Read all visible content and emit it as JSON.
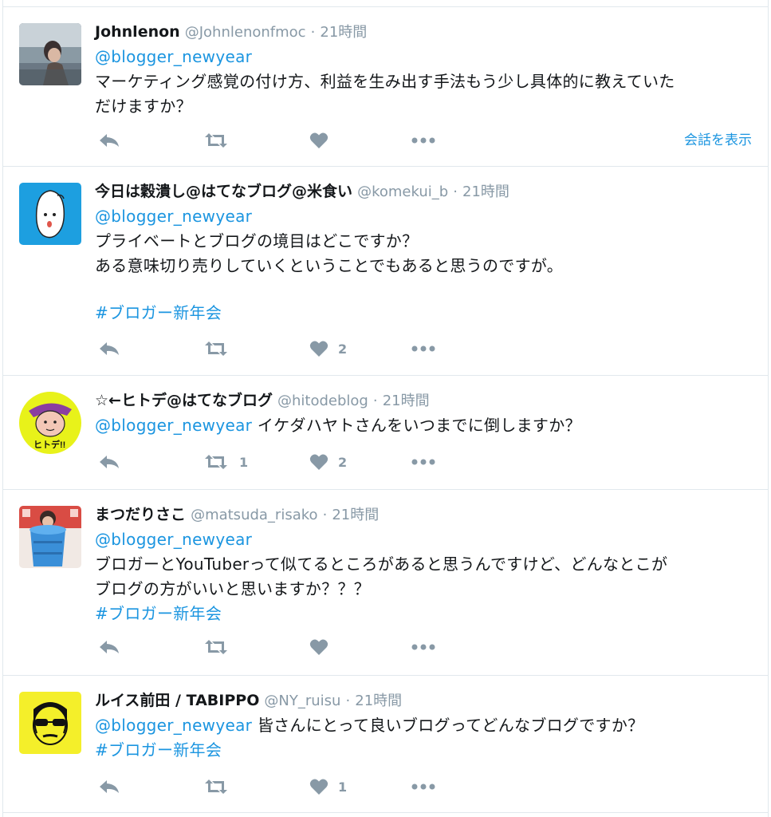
{
  "tweets": [
    {
      "name": "Johnlenon",
      "handle": "@Johnlenonfmoc",
      "time": "21時間",
      "lines": [
        [
          {
            "t": "mention",
            "v": "@blogger_newyear"
          }
        ],
        [
          {
            "t": "text",
            "v": "マーケティング感覚の付け方、利益を生み出す手法もう少し具体的に教えていた"
          }
        ],
        [
          {
            "t": "text",
            "v": "だけますか？"
          }
        ]
      ],
      "likes": "",
      "retweets": "",
      "show_conversation": "会話を表示"
    },
    {
      "name": "今日は穀潰し@はてなブログ@米食い",
      "handle": "@komekui_b",
      "time": "21時間",
      "lines": [
        [
          {
            "t": "mention",
            "v": "@blogger_newyear"
          }
        ],
        [
          {
            "t": "text",
            "v": "プライベートとブログの境目はどこですか？"
          }
        ],
        [
          {
            "t": "text",
            "v": "ある意味切り売りしていくということでもあると思うのですが。"
          }
        ],
        [
          {
            "t": "text",
            "v": ""
          }
        ],
        [
          {
            "t": "hashtag",
            "v": " #ブロガー新年会"
          }
        ]
      ],
      "likes": "2",
      "retweets": ""
    },
    {
      "name": "☆←ヒトデ@はてなブログ",
      "handle": "@hitodeblog",
      "time": "21時間",
      "lines": [
        [
          {
            "t": "mention",
            "v": "@blogger_newyear"
          },
          {
            "t": "text",
            "v": " イケダハヤトさんをいつまでに倒しますか？"
          }
        ]
      ],
      "likes": "2",
      "retweets": "1"
    },
    {
      "name": "まつだりさこ",
      "handle": "@matsuda_risako",
      "time": "21時間",
      "lines": [
        [
          {
            "t": "mention",
            "v": "@blogger_newyear"
          }
        ],
        [
          {
            "t": "text",
            "v": "ブロガーとYouTuberって似てるところがあると思うんですけど、どんなとこが"
          }
        ],
        [
          {
            "t": "text",
            "v": "ブログの方がいいと思いますか？？？"
          }
        ],
        [
          {
            "t": "hashtag",
            "v": "#ブロガー新年会"
          }
        ]
      ],
      "likes": "",
      "retweets": ""
    },
    {
      "name": "ルイス前田 / TABIPPO",
      "handle": "@NY_ruisu",
      "time": "21時間",
      "lines": [
        [
          {
            "t": "mention",
            "v": "@blogger_newyear"
          },
          {
            "t": "text",
            "v": " 皆さんにとって良いブログってどんなブログですか？"
          }
        ],
        [
          {
            "t": "hashtag",
            "v": "#ブロガー新年会"
          }
        ]
      ],
      "likes": "1",
      "retweets": ""
    }
  ],
  "separator": "·",
  "colors": {
    "link": "#1b95e0",
    "muted": "#8899a6",
    "text": "#14171a",
    "border": "#e1e8ed"
  },
  "icons": [
    "reply-icon",
    "retweet-icon",
    "heart-icon",
    "more-icon"
  ]
}
